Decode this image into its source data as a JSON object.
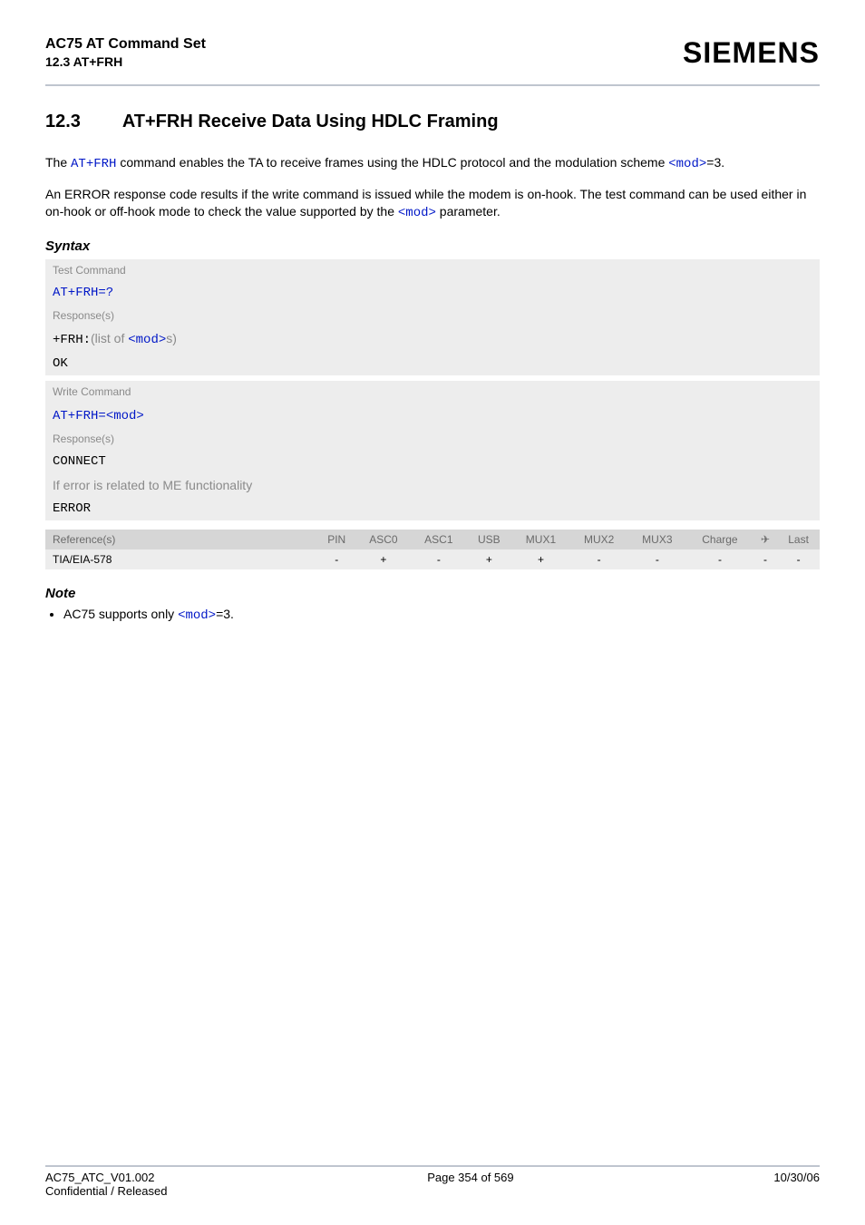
{
  "header": {
    "doc_title": "AC75 AT Command Set",
    "doc_subtitle": "12.3 AT+FRH",
    "brand": "SIEMENS"
  },
  "section": {
    "number": "12.3",
    "title": "AT+FRH   Receive Data Using HDLC Framing"
  },
  "intro": {
    "p1_a": "The ",
    "p1_cmd": "AT+FRH",
    "p1_b": " command enables the TA to receive frames using the HDLC protocol and the modulation scheme ",
    "p1_mod": "<mod>",
    "p1_c": "=3.",
    "p2_a": "An ERROR response code results if the write command is issued while the modem is on-hook. The test command can be used either in on-hook or off-hook mode to check the value supported by the ",
    "p2_mod": "<mod>",
    "p2_b": " parameter."
  },
  "syntax": {
    "heading": "Syntax",
    "test_label": "Test Command",
    "test_cmd": "AT+FRH=?",
    "responses_label": "Response(s)",
    "test_resp_prefix": "+FRH:",
    "test_resp_mid": "(list of ",
    "test_resp_mod": "<mod>",
    "test_resp_suffix": "s)",
    "ok": "OK",
    "write_label": "Write Command",
    "write_cmd_prefix": "AT+FRH=",
    "write_cmd_mod": "<mod>",
    "write_resp_connect": "CONNECT",
    "write_resp_err_text": "If error is related to ME functionality",
    "write_resp_error": "ERROR"
  },
  "reftable": {
    "headers": [
      "Reference(s)",
      "PIN",
      "ASC0",
      "ASC1",
      "USB",
      "MUX1",
      "MUX2",
      "MUX3",
      "Charge",
      "✈",
      "Last"
    ],
    "row_label": "TIA/EIA-578",
    "values": [
      "-",
      "+",
      "-",
      "+",
      "+",
      "-",
      "-",
      "-",
      "-",
      "-"
    ]
  },
  "note": {
    "heading": "Note",
    "bullet_a": "AC75 supports only ",
    "bullet_mod": "<mod>",
    "bullet_b": "=3."
  },
  "footer": {
    "left1": "AC75_ATC_V01.002",
    "left2": "Confidential / Released",
    "center": "Page 354 of 569",
    "right": "10/30/06"
  }
}
